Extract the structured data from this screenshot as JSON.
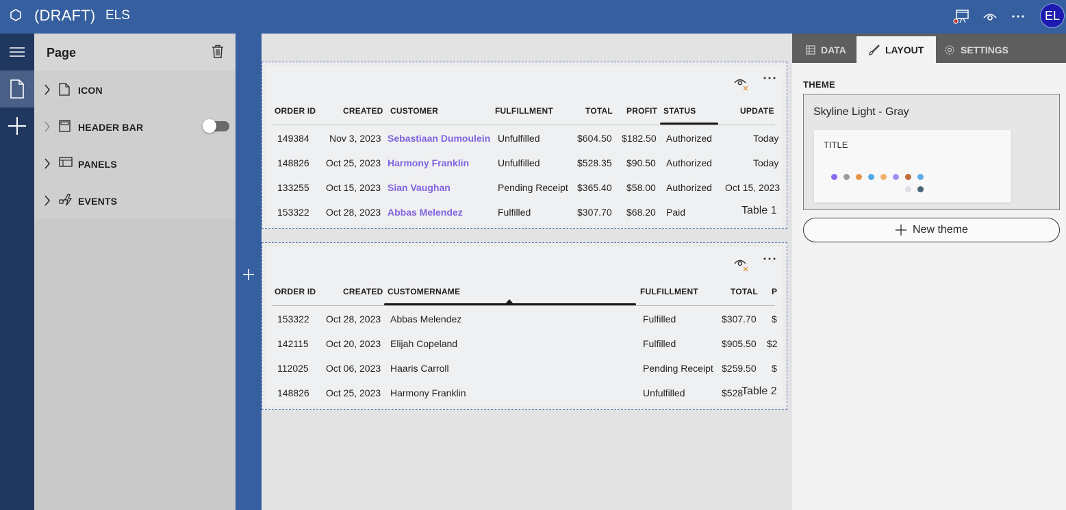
{
  "header": {
    "draft_label": "(DRAFT)",
    "app_name": "ELS",
    "avatar_initials": "EL"
  },
  "page_panel": {
    "title": "Page",
    "items": [
      {
        "label": "ICON"
      },
      {
        "label": "HEADER BAR",
        "toggle": false
      },
      {
        "label": "PANELS"
      },
      {
        "label": "EVENTS"
      }
    ]
  },
  "table1": {
    "caption": "Table 1",
    "columns": [
      "ORDER ID",
      "CREATED",
      "CUSTOMER",
      "FULFILLMENT",
      "TOTAL",
      "PROFIT",
      "STATUS",
      "UPDATE"
    ],
    "rows": [
      [
        "149384",
        "Nov 3, 2023",
        "Sebastiaan Dumoulein",
        "Unfulfilled",
        "$604.50",
        "$182.50",
        "Authorized",
        "Today"
      ],
      [
        "148826",
        "Oct 25, 2023",
        "Harmony Franklin",
        "Unfulfilled",
        "$528.35",
        "$90.50",
        "Authorized",
        "Today"
      ],
      [
        "133255",
        "Oct 15, 2023",
        "Sian Vaughan",
        "Pending Receipt",
        "$365.40",
        "$58.00",
        "Authorized",
        "Oct 15, 2023"
      ],
      [
        "153322",
        "Oct 28, 2023",
        "Abbas Melendez",
        "Fulfilled",
        "$307.70",
        "$68.20",
        "Paid",
        ""
      ]
    ]
  },
  "table2": {
    "caption": "Table 2",
    "columns": [
      "ORDER ID",
      "CREATED",
      "CUSTOMERNAME",
      "FULFILLMENT",
      "TOTAL",
      "P"
    ],
    "rows": [
      [
        "153322",
        "Oct 28, 2023",
        "Abbas Melendez",
        "Fulfilled",
        "$307.70",
        "$"
      ],
      [
        "142115",
        "Oct 20, 2023",
        "Elijah Copeland",
        "Fulfilled",
        "$905.50",
        "$2"
      ],
      [
        "112025",
        "Oct 06, 2023",
        "Haaris Carroll",
        "Pending Receipt",
        "$259.50",
        "$"
      ],
      [
        "148826",
        "Oct 25, 2023",
        "Harmony Franklin",
        "Unfulfilled",
        "$528",
        ""
      ]
    ]
  },
  "right_panel": {
    "tabs": [
      "DATA",
      "LAYOUT",
      "SETTINGS"
    ],
    "active_tab": "LAYOUT",
    "theme_heading": "THEME",
    "theme_name": "Skyline Light - Gray",
    "preview_title": "TITLE",
    "palette": [
      "#8b6cf0",
      "#9a9a9a",
      "#e8954a",
      "#55a9e8",
      "#f0b06a",
      "#a88cf2",
      "#c06a3a",
      "#5aaee8",
      "#e2dce4",
      "#4a6678"
    ],
    "new_theme_label": "New theme"
  },
  "colors": {
    "header_blue": "#355f9e",
    "rail": "#20385f",
    "link_purple": "#8063e0",
    "avatar": "#1c1ab0"
  }
}
